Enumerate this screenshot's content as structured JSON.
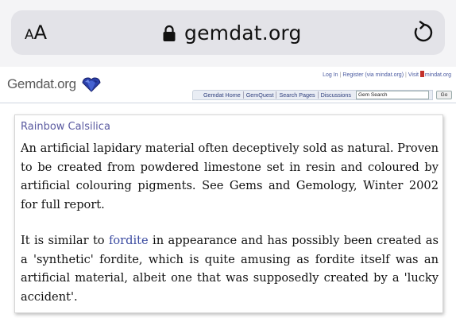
{
  "browser": {
    "text_size_small": "A",
    "text_size_big": "A",
    "url": "gemdat.org"
  },
  "site": {
    "logo_text": "Gemdat.org",
    "top_links": {
      "login": "Log In",
      "register": "Register (via mindat.org)",
      "visit_prefix": "Visit",
      "mindat": "mindat.org"
    },
    "nav": {
      "items": [
        "Gemdat Home",
        "GemQuest",
        "Search Pages",
        "Discussions"
      ],
      "search_value": "Gem Search",
      "go_label": "Go"
    }
  },
  "entry": {
    "title": "Rainbow Calsilica",
    "paragraph1": "An artificial lapidary material often deceptively sold as natural. Proven to be created from powdered limestone set in resin and coloured by artificial colouring pigments. See Gems and Gemology, Winter 2002 for full report.",
    "paragraph2_before": "It is similar to ",
    "paragraph2_link": "fordite",
    "paragraph2_after": " in appearance and has possibly been created as a 'synthetic' fordite, which is quite amusing as fordite itself was an artificial material, albeit one that was supposedly created by a 'lucky accident'."
  },
  "colors": {
    "link": "#3a4aa0",
    "title": "#5a5aa0",
    "browser_bg": "#f4f4f6",
    "url_pill": "#e3e3e8"
  },
  "icons": [
    "lock-icon",
    "reload-icon",
    "gem-logo-icon",
    "mindat-icon"
  ]
}
